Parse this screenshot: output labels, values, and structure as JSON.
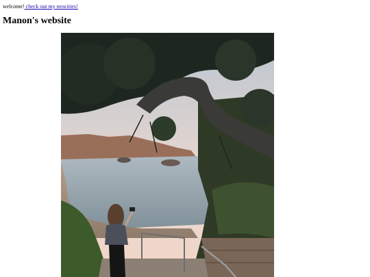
{
  "header": {
    "welcome_text": "welcome!",
    "link_text": " check out my neocities!"
  },
  "title": "Manon's website",
  "photo": {
    "alt": "photo of a person taking a picture at a rocky cove framed by a leaning pine tree at dusk"
  },
  "colors": {
    "link": "#1a0dab",
    "background": "#ffffff"
  }
}
